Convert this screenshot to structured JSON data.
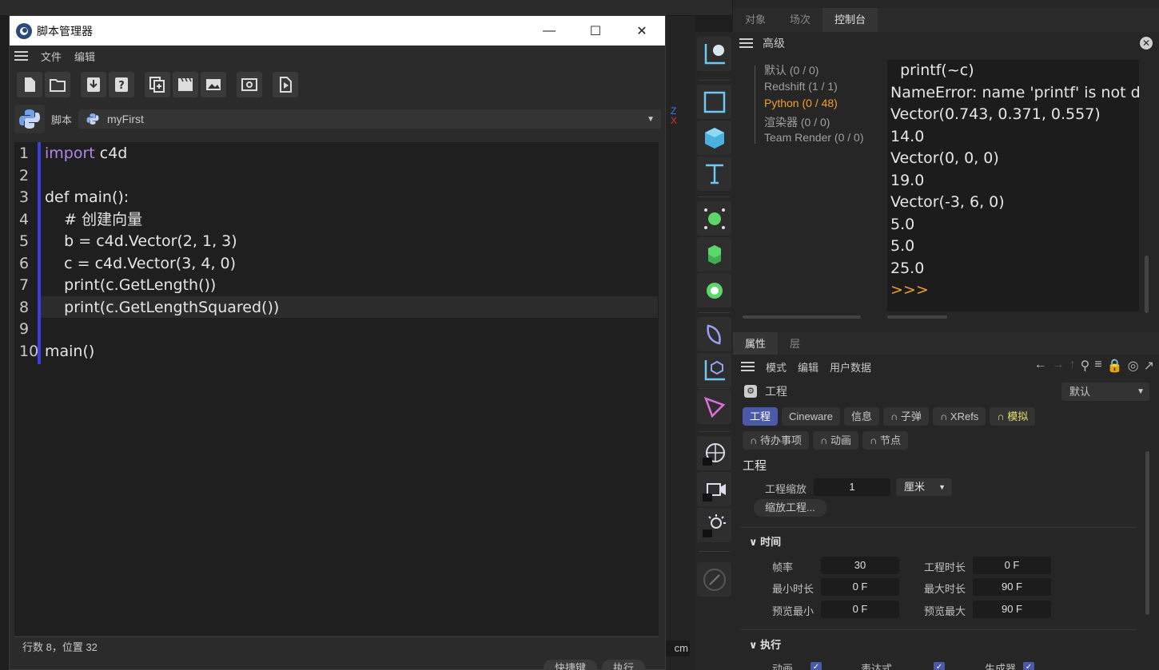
{
  "script_manager": {
    "title": "脚本管理器",
    "menu": [
      "文件",
      "编辑"
    ],
    "script_label": "脚本",
    "script_name": "myFirst",
    "code_lines": [
      {
        "n": "1",
        "text": "import c4d"
      },
      {
        "n": "2",
        "text": ""
      },
      {
        "n": "3",
        "text": "def main():"
      },
      {
        "n": "4",
        "text": "    # 创建向量"
      },
      {
        "n": "5",
        "text": "    b = c4d.Vector(2, 1, 3)"
      },
      {
        "n": "6",
        "text": "    c = c4d.Vector(3, 4, 0)"
      },
      {
        "n": "7",
        "text": "    print(c.GetLength())"
      },
      {
        "n": "8",
        "text": "    print(c.GetLengthSquared())"
      },
      {
        "n": "9",
        "text": ""
      },
      {
        "n": "10",
        "text": "main()"
      }
    ],
    "status": "行数 8，位置 32",
    "shortcut_button": "快捷键",
    "execute_button": "执行"
  },
  "top_tabs": [
    "对象",
    "场次",
    "控制台"
  ],
  "console": {
    "title": "高级",
    "tree": [
      "默认 (0 / 0)",
      "Redshift (1 / 1)",
      "Python (0 / 48)",
      "渲染器 (0 / 0)",
      "Team Render  (0 / 0)"
    ],
    "output": [
      "  printf(~c)",
      "NameError: name 'printf' is not d",
      "Vector(0.743, 0.371, 0.557)",
      "14.0",
      "Vector(0, 0, 0)",
      "19.0",
      "Vector(-3, 6, 0)",
      "5.0",
      "5.0",
      "25.0",
      ">>>"
    ]
  },
  "attributes": {
    "tabs": [
      "属性",
      "层"
    ],
    "menu": [
      "模式",
      "编辑",
      "用户数据"
    ],
    "object": "工程",
    "mode": "默认",
    "pills_row1": [
      "工程",
      "Cineware",
      "信息",
      "子弹",
      "XRefs",
      "模拟"
    ],
    "pills_row2": [
      "待办事项",
      "动画",
      "节点"
    ],
    "section": "工程",
    "scale_label": "工程缩放",
    "scale_value": "1",
    "scale_unit": "厘米",
    "scale_button": "缩放工程...",
    "time_group": "时间",
    "fps_label": "帧率",
    "fps_value": "30",
    "duration_label": "工程时长",
    "duration_value": "0 F",
    "min_label": "最小时长",
    "min_value": "0 F",
    "max_label": "最大时长",
    "max_value": "90 F",
    "pmin_label": "预览最小",
    "pmin_value": "0 F",
    "pmax_label": "预览最大",
    "pmax_value": "90 F",
    "exec_group": "执行",
    "exec_items": [
      "动画",
      "表达式",
      "生成器"
    ]
  },
  "viewport": {
    "unit": "cm"
  }
}
